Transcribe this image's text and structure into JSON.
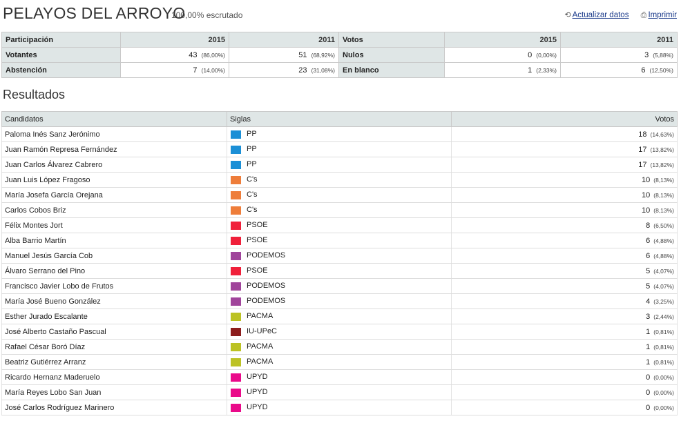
{
  "header": {
    "title": "PELAYOS DEL ARROYO",
    "scrutiny": "100,00% escrutado",
    "refresh_label": "Actualizar datos",
    "print_label": "Imprimir"
  },
  "participation": {
    "header": "Participación",
    "year_new": "2015",
    "year_old": "2011",
    "rows": [
      {
        "label": "Votantes",
        "v2015": "43",
        "p2015": "(86,00%)",
        "v2011": "51",
        "p2011": "(68,92%)"
      },
      {
        "label": "Abstención",
        "v2015": "7",
        "p2015": "(14,00%)",
        "v2011": "23",
        "p2011": "(31,08%)"
      }
    ]
  },
  "votes_summary": {
    "header": "Votos",
    "year_new": "2015",
    "year_old": "2011",
    "rows": [
      {
        "label": "Nulos",
        "v2015": "0",
        "p2015": "(0,00%)",
        "v2011": "3",
        "p2011": "(5,88%)"
      },
      {
        "label": "En blanco",
        "v2015": "1",
        "p2015": "(2,33%)",
        "v2011": "6",
        "p2011": "(12,50%)"
      }
    ]
  },
  "results": {
    "section_title": "Resultados",
    "col_candidates": "Candidatos",
    "col_party": "Siglas",
    "col_votes": "Votos",
    "rows": [
      {
        "name": "Paloma Inés Sanz Jerónimo",
        "party": "PP",
        "color": "#1b8fd6",
        "votes": "18",
        "pct": "(14,63%)"
      },
      {
        "name": "Juan Ramón Represa Fernández",
        "party": "PP",
        "color": "#1b8fd6",
        "votes": "17",
        "pct": "(13,82%)"
      },
      {
        "name": "Juan Carlos Álvarez Cabrero",
        "party": "PP",
        "color": "#1b8fd6",
        "votes": "17",
        "pct": "(13,82%)"
      },
      {
        "name": "Juan Luis López Fragoso",
        "party": "C's",
        "color": "#ee7d3a",
        "votes": "10",
        "pct": "(8,13%)"
      },
      {
        "name": "María Josefa García Orejana",
        "party": "C's",
        "color": "#ee7d3a",
        "votes": "10",
        "pct": "(8,13%)"
      },
      {
        "name": "Carlos Cobos Briz",
        "party": "C's",
        "color": "#ee7d3a",
        "votes": "10",
        "pct": "(8,13%)"
      },
      {
        "name": "Félix Montes Jort",
        "party": "PSOE",
        "color": "#f0203a",
        "votes": "8",
        "pct": "(6,50%)"
      },
      {
        "name": "Alba Barrio Martín",
        "party": "PSOE",
        "color": "#f0203a",
        "votes": "6",
        "pct": "(4,88%)"
      },
      {
        "name": "Manuel Jesús García Cob",
        "party": "PODEMOS",
        "color": "#a0449b",
        "votes": "6",
        "pct": "(4,88%)"
      },
      {
        "name": "Álvaro Serrano del Pino",
        "party": "PSOE",
        "color": "#f0203a",
        "votes": "5",
        "pct": "(4,07%)"
      },
      {
        "name": "Francisco Javier Lobo de Frutos",
        "party": "PODEMOS",
        "color": "#a0449b",
        "votes": "5",
        "pct": "(4,07%)"
      },
      {
        "name": "María José Bueno González",
        "party": "PODEMOS",
        "color": "#a0449b",
        "votes": "4",
        "pct": "(3,25%)"
      },
      {
        "name": "Esther Jurado Escalante",
        "party": "PACMA",
        "color": "#bcc224",
        "votes": "3",
        "pct": "(2,44%)"
      },
      {
        "name": "José Alberto Castaño Pascual",
        "party": "IU-UPeC",
        "color": "#8c1c1c",
        "votes": "1",
        "pct": "(0,81%)"
      },
      {
        "name": "Rafael César Boró Díaz",
        "party": "PACMA",
        "color": "#bcc224",
        "votes": "1",
        "pct": "(0,81%)"
      },
      {
        "name": "Beatriz Gutiérrez Arranz",
        "party": "PACMA",
        "color": "#bcc224",
        "votes": "1",
        "pct": "(0,81%)"
      },
      {
        "name": "Ricardo Hernanz Maderuelo",
        "party": "UPYD",
        "color": "#ea0a8a",
        "votes": "0",
        "pct": "(0,00%)"
      },
      {
        "name": "María Reyes Lobo San Juan",
        "party": "UPYD",
        "color": "#ea0a8a",
        "votes": "0",
        "pct": "(0,00%)"
      },
      {
        "name": "José Carlos Rodríguez Marinero",
        "party": "UPYD",
        "color": "#ea0a8a",
        "votes": "0",
        "pct": "(0,00%)"
      }
    ]
  }
}
